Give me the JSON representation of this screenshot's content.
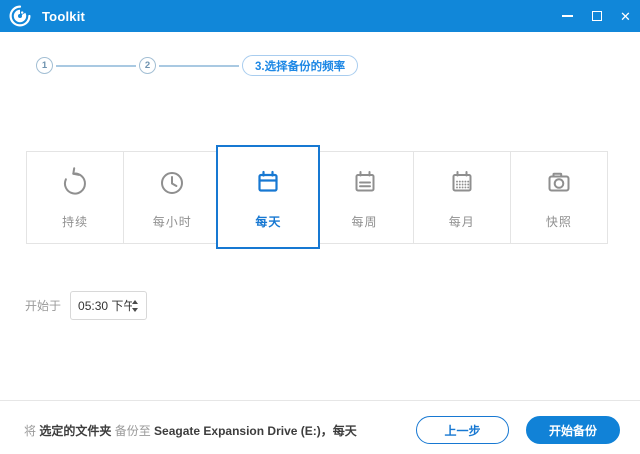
{
  "window": {
    "title": "Toolkit",
    "close_glyph": "✕"
  },
  "colors": {
    "titlebar_blue": "#1187d9",
    "accent_blue": "#1778d2",
    "button_blue": "#1182d7",
    "step_active_blue": "#1e88e5",
    "step_muted": "#6f93b0",
    "icon_gray": "#8f8f8f",
    "text_dark": "#3d3d3d",
    "text_gray": "#9a9a9a"
  },
  "stepper": {
    "steps": [
      {
        "number": "1"
      },
      {
        "number": "2"
      }
    ],
    "active_step_label": "3.选择备份的频率"
  },
  "frequency_options": [
    {
      "label": "持续",
      "icon": "loop-icon",
      "selected": false
    },
    {
      "label": "每小时",
      "icon": "clock-icon",
      "selected": false
    },
    {
      "label": "每天",
      "icon": "calendar-day-icon",
      "selected": true
    },
    {
      "label": "每周",
      "icon": "calendar-week-icon",
      "selected": false
    },
    {
      "label": "每月",
      "icon": "calendar-month-icon",
      "selected": false
    },
    {
      "label": "快照",
      "icon": "camera-icon",
      "selected": false
    }
  ],
  "schedule": {
    "label": "开始于",
    "time_value": "05:30 下午"
  },
  "footer": {
    "summary_parts": [
      {
        "text": "将 "
      },
      {
        "text": "选定的文件夹"
      },
      {
        "text": " 备份至 "
      },
      {
        "text": "Seagate Expansion Drive (E:)"
      },
      {
        "text": "，"
      },
      {
        "text": "每天"
      }
    ],
    "back_button": "上一步",
    "start_button": "开始备份"
  }
}
